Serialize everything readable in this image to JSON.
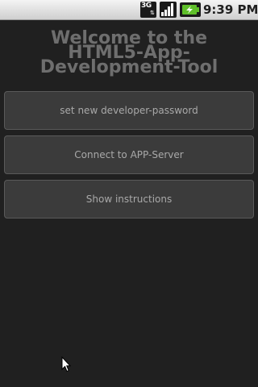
{
  "status_bar": {
    "network_label": "3G",
    "time": "9:39 PM",
    "icons": [
      "3g-data-icon",
      "signal-strength-icon",
      "battery-charging-icon"
    ],
    "colors": {
      "battery_fill": "#5fbf2a",
      "background": "#e6e6e6"
    }
  },
  "main": {
    "title_lines": [
      "Welcome to the",
      "HTML5-App-",
      "Development-Tool"
    ],
    "buttons": [
      {
        "label": "set new developer-password"
      },
      {
        "label": "Connect to APP-Server"
      },
      {
        "label": "Show instructions"
      }
    ]
  },
  "colors": {
    "background": "#202020",
    "button_bg": "#3b3b3b",
    "button_text": "#a9a9a9",
    "title_text": "#6e6e6e"
  }
}
